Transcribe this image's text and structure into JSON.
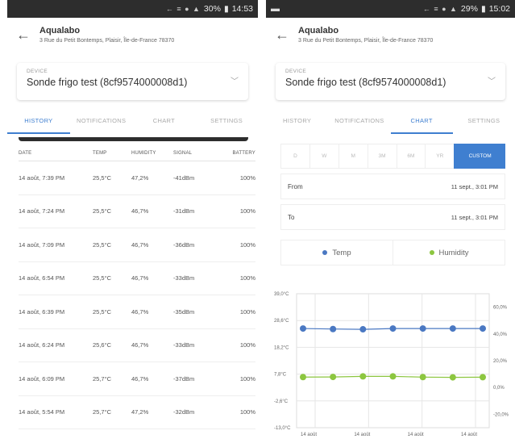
{
  "left": {
    "status": {
      "icons": "← ≡ ● ▲",
      "battery": "30%",
      "time": "14:53"
    },
    "header": {
      "title": "Aqualabo",
      "address": "3 Rue du Petit Bontemps, Plaisir, Île-de-France 78370"
    },
    "device": {
      "label": "DEVICE",
      "value": "Sonde frigo test (8cf9574000008d1)"
    },
    "tabs": [
      {
        "label": "HISTORY",
        "active": true
      },
      {
        "label": "NOTIFICATIONS",
        "active": false
      },
      {
        "label": "CHART",
        "active": false
      },
      {
        "label": "SETTINGS",
        "active": false
      }
    ],
    "table": {
      "headers": [
        "DATE",
        "TEMP",
        "HUMIDITY",
        "SIGNAL",
        "BATTERY"
      ],
      "rows": [
        [
          "14 août, 7:39 PM",
          "25,5°C",
          "47,2%",
          "-41dBm",
          "100%"
        ],
        [
          "14 août, 7:24 PM",
          "25,5°C",
          "46,7%",
          "-31dBm",
          "100%"
        ],
        [
          "14 août, 7:09 PM",
          "25,5°C",
          "46,7%",
          "-36dBm",
          "100%"
        ],
        [
          "14 août, 6:54 PM",
          "25,5°C",
          "46,7%",
          "-33dBm",
          "100%"
        ],
        [
          "14 août, 6:39 PM",
          "25,5°C",
          "46,7%",
          "-35dBm",
          "100%"
        ],
        [
          "14 août, 6:24 PM",
          "25,6°C",
          "46,7%",
          "-33dBm",
          "100%"
        ],
        [
          "14 août, 6:09 PM",
          "25,7°C",
          "46,7%",
          "-37dBm",
          "100%"
        ],
        [
          "14 août, 5:54 PM",
          "25,7°C",
          "47,2%",
          "-32dBm",
          "100%"
        ]
      ]
    }
  },
  "right": {
    "status": {
      "icons": "← ≡ ● ▲",
      "battery": "29%",
      "time": "15:02"
    },
    "header": {
      "title": "Aqualabo",
      "address": "3 Rue du Petit Bontemps, Plaisir, Île-de-France 78370"
    },
    "device": {
      "label": "DEVICE",
      "value": "Sonde frigo test (8cf9574000008d1)"
    },
    "tabs": [
      {
        "label": "HISTORY",
        "active": false
      },
      {
        "label": "NOTIFICATIONS",
        "active": false
      },
      {
        "label": "CHART",
        "active": true
      },
      {
        "label": "SETTINGS",
        "active": false
      }
    ],
    "ranges": [
      {
        "label": "D",
        "active": false
      },
      {
        "label": "W",
        "active": false
      },
      {
        "label": "M",
        "active": false
      },
      {
        "label": "3M",
        "active": false
      },
      {
        "label": "6M",
        "active": false
      },
      {
        "label": "YR",
        "active": false
      },
      {
        "label": "CUSTOM",
        "active": true
      }
    ],
    "from": {
      "label": "From",
      "value": "11 sept., 3:01 PM"
    },
    "to": {
      "label": "To",
      "value": "11 sept., 3:01 PM"
    },
    "legend": [
      {
        "label": "Temp",
        "color": "#4a78c2"
      },
      {
        "label": "Humidity",
        "color": "#8cc63f"
      }
    ]
  },
  "chart_data": {
    "type": "line",
    "x": [
      "14 août",
      "14 août",
      "14 août",
      "14 août",
      "14 août",
      "14 août",
      "14 août"
    ],
    "x_tick_labels": [
      "14 août",
      "14 août",
      "14 août",
      "14 août"
    ],
    "y_left_ticks": [
      "39,0°C",
      "28,6°C",
      "18,2°C",
      "7,8°C",
      "-2,6°C",
      "-13,0°C"
    ],
    "y_right_ticks": [
      "60,0%",
      "40,0%",
      "20,0%",
      "0,0%",
      "-20,0%"
    ],
    "ylim_left": [
      -13.0,
      39.0
    ],
    "ylim_right": [
      -30.0,
      70.0
    ],
    "grid": true,
    "legend": "top",
    "series": [
      {
        "name": "Temp",
        "axis": "left",
        "color": "#4a78c2",
        "values": [
          25.5,
          25.3,
          25.2,
          25.5,
          25.5,
          25.5,
          25.5
        ]
      },
      {
        "name": "Humidity",
        "axis": "right",
        "color": "#8cc63f",
        "values": [
          7.8,
          7.9,
          8.3,
          8.3,
          7.8,
          7.6,
          7.7
        ]
      }
    ]
  },
  "colors": {
    "accent": "#3f7fd0",
    "statusbar": "#2d2d2d"
  }
}
